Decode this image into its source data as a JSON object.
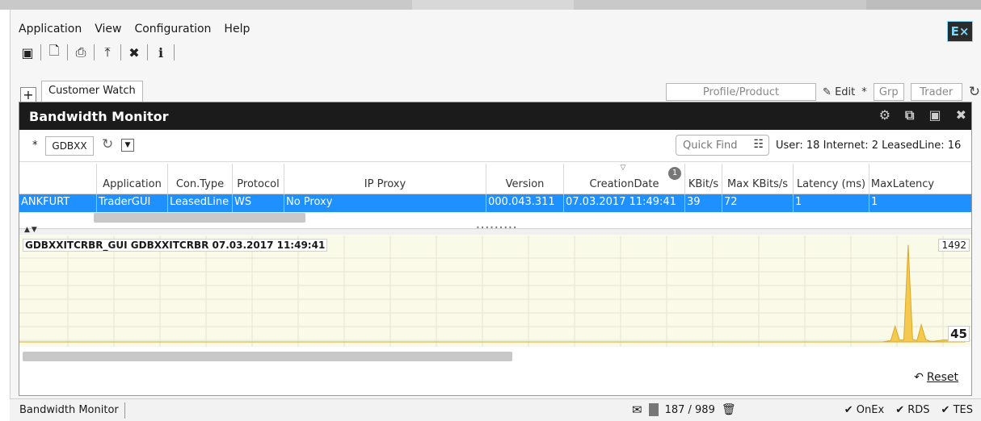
{
  "menu": {
    "items": [
      "Application",
      "View",
      "Configuration",
      "Help"
    ]
  },
  "brand": {
    "logo_text": "E×"
  },
  "toolbar": {
    "icons": [
      "login-icon",
      "new-document-icon",
      "print-icon",
      "upload-icon",
      "tools-icon",
      "info-icon"
    ]
  },
  "tabs": {
    "add_label": "+",
    "active_tab": "Customer Watch",
    "profile_placeholder": "Profile/Product",
    "edit_label": "Edit",
    "star": "*",
    "grp_label": "Grp",
    "trader_label": "Trader"
  },
  "panel": {
    "title": "Bandwidth Monitor",
    "filter": {
      "star": "*",
      "value": "GDBXX"
    },
    "quick_find_placeholder": "Quick Find",
    "stats_text": "User: 18 Internet: 2 LeasedLine: 16"
  },
  "grid": {
    "columns": [
      "",
      "Application",
      "Con.Type",
      "Protocol",
      "IP Proxy",
      "Version",
      "CreationDate",
      "KBit/s",
      "Max KBits/s",
      "Latency (ms)",
      "MaxLatency"
    ],
    "creation_badge": "1",
    "rows": [
      [
        "ANKFURT",
        "TraderGUI",
        "LeasedLine",
        "WS",
        "No Proxy",
        "000.043.311",
        "07.03.2017 11:49:41",
        "39",
        "72",
        "1",
        "1"
      ]
    ]
  },
  "chart": {
    "caption": "GDBXXITCRBR_GUI   GDBXXITCRBR   07.03.2017 11:49:41",
    "ymax_label": "1492",
    "current_label": "45",
    "fill_color": "#f5c94d",
    "bg_color": "#fafae9"
  },
  "chart_data": {
    "type": "area",
    "ylim": [
      0,
      1492
    ],
    "values": [
      0,
      0,
      0,
      0,
      0,
      0,
      0,
      0,
      0,
      0,
      0,
      0,
      0,
      0,
      0,
      0,
      0,
      0,
      0,
      0,
      0,
      0,
      0,
      0,
      0,
      0,
      0,
      0,
      0,
      0,
      0,
      0,
      0,
      0,
      0,
      0,
      0,
      0,
      0,
      0,
      0,
      0,
      0,
      0,
      0,
      0,
      0,
      0,
      0,
      0,
      0,
      0,
      0,
      0,
      0,
      0,
      0,
      0,
      0,
      0,
      0,
      0,
      0,
      0,
      0,
      0,
      0,
      0,
      0,
      0,
      0,
      0,
      0,
      0,
      0,
      0,
      0,
      0,
      0,
      0,
      0,
      0,
      0,
      0,
      0,
      0,
      0,
      0,
      0,
      0,
      0,
      0,
      0,
      0,
      0,
      0,
      0,
      0,
      0,
      0,
      0,
      0,
      0,
      0,
      0,
      0,
      0,
      0,
      0,
      0,
      0,
      0,
      0,
      0,
      0,
      0,
      0,
      0,
      0,
      0,
      0,
      0,
      0,
      0,
      0,
      0,
      0,
      0,
      0,
      0,
      0,
      0,
      0,
      0,
      0,
      0,
      0,
      0,
      0,
      0,
      0,
      0,
      0,
      0,
      0,
      0,
      0,
      0,
      0,
      0,
      0,
      0,
      0,
      0,
      0,
      0,
      0,
      0,
      0,
      0,
      0,
      0,
      0,
      0,
      0,
      0,
      0,
      0,
      0,
      0,
      0,
      0,
      0,
      0,
      0,
      0,
      0,
      0,
      0,
      0,
      0,
      0,
      0,
      0,
      0,
      0,
      0,
      0,
      0,
      0,
      0,
      0,
      0,
      0,
      0,
      0,
      0,
      0,
      0,
      10,
      20,
      240,
      30,
      30,
      1470,
      40,
      20,
      260,
      40,
      10,
      10,
      20,
      30,
      30,
      40,
      30,
      40,
      45
    ]
  },
  "reset": {
    "label": "Reset"
  },
  "status": {
    "left": "Bandwidth Monitor",
    "count": "187 / 989",
    "checks": [
      "OnEx",
      "RDS",
      "TES"
    ]
  }
}
